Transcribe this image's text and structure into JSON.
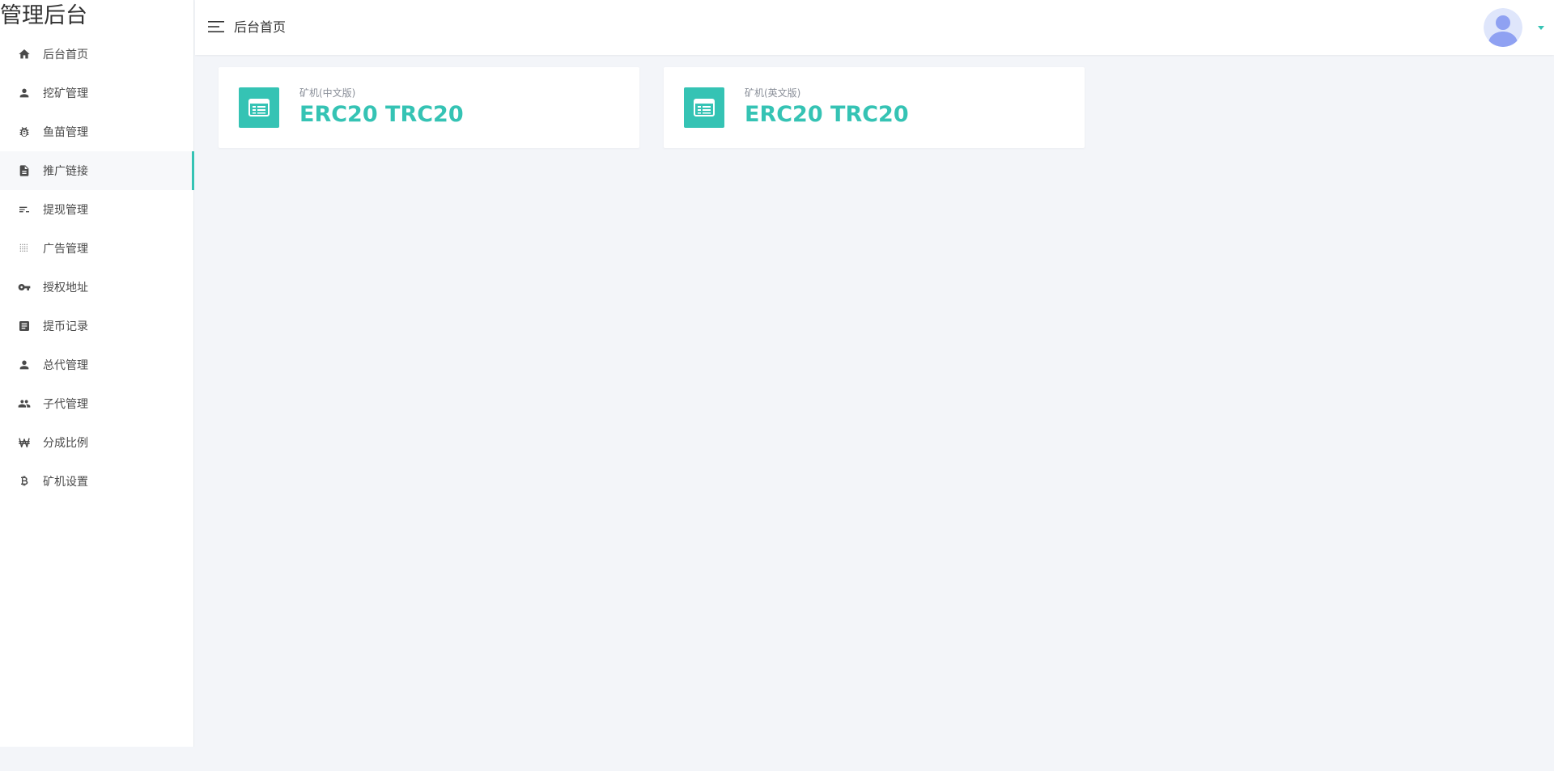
{
  "app": {
    "brand_title": "管理后台"
  },
  "colors": {
    "accent": "#35c3b4",
    "sidebar_bg": "#ffffff",
    "content_bg": "#f3f5f9",
    "icon_dark": "#4a4a4a",
    "avatar_bg": "#dfe6fb",
    "avatar_fg": "#8fa1f2"
  },
  "sidebar": {
    "items": [
      {
        "label": "后台首页",
        "icon": "home-icon",
        "active": false
      },
      {
        "label": "挖矿管理",
        "icon": "person-icon",
        "active": false
      },
      {
        "label": "鱼苗管理",
        "icon": "bug-icon",
        "active": false
      },
      {
        "label": "推广链接",
        "icon": "document-icon",
        "active": true
      },
      {
        "label": "提现管理",
        "icon": "short-text-icon",
        "active": false
      },
      {
        "label": "广告管理",
        "icon": "dot-grid-icon",
        "active": false
      },
      {
        "label": "授权地址",
        "icon": "key-icon",
        "active": false
      },
      {
        "label": "提币记录",
        "icon": "list-box-icon",
        "active": false
      },
      {
        "label": "总代管理",
        "icon": "person-icon",
        "active": false
      },
      {
        "label": "子代管理",
        "icon": "people-icon",
        "active": false
      },
      {
        "label": "分成比例",
        "icon": "won-icon",
        "active": false
      },
      {
        "label": "矿机设置",
        "icon": "bitcoin-icon",
        "active": false
      }
    ]
  },
  "header": {
    "title": "后台首页",
    "toggle_icon": "menu-lines-icon",
    "avatar_icon": "user-avatar-icon",
    "caret_icon": "caret-down-icon"
  },
  "cards": [
    {
      "subtitle": "矿机(中文版)",
      "value": "ERC20 TRC20",
      "icon": "card-list-icon"
    },
    {
      "subtitle": "矿机(英文版)",
      "value": "ERC20 TRC20",
      "icon": "card-list-icon"
    }
  ]
}
